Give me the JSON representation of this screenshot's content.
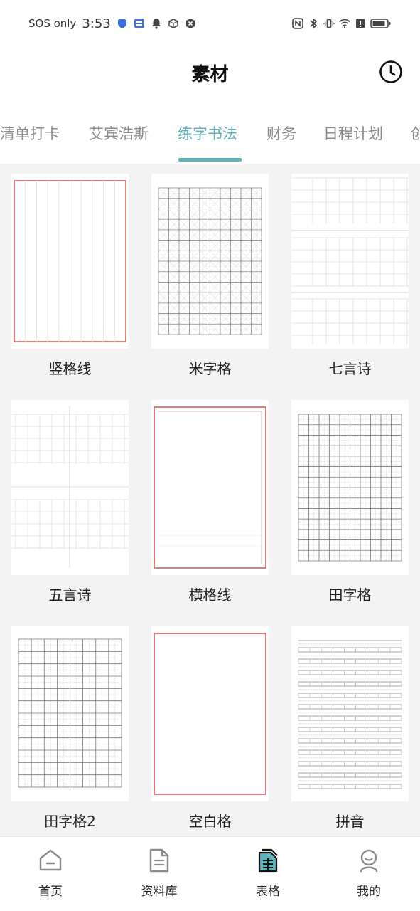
{
  "status": {
    "carrier": "SOS only",
    "time": "3:53"
  },
  "header": {
    "title": "素材"
  },
  "tabs": [
    {
      "label": "清单打卡"
    },
    {
      "label": "艾宾浩斯"
    },
    {
      "label": "练字书法"
    },
    {
      "label": "财务"
    },
    {
      "label": "日程计划"
    },
    {
      "label": "创"
    }
  ],
  "templates": [
    {
      "label": "竖格线"
    },
    {
      "label": "米字格"
    },
    {
      "label": "七言诗"
    },
    {
      "label": "五言诗"
    },
    {
      "label": "横格线"
    },
    {
      "label": "田字格"
    },
    {
      "label": "田字格2"
    },
    {
      "label": "空白格"
    },
    {
      "label": "拼音"
    }
  ],
  "nav": [
    {
      "label": "首页",
      "icon": "home-icon"
    },
    {
      "label": "资料库",
      "icon": "document-icon"
    },
    {
      "label": "表格",
      "icon": "table-icon"
    },
    {
      "label": "我的",
      "icon": "profile-icon"
    }
  ],
  "colors": {
    "accent": "#5fb3bb",
    "red_border": "#d9534f"
  }
}
